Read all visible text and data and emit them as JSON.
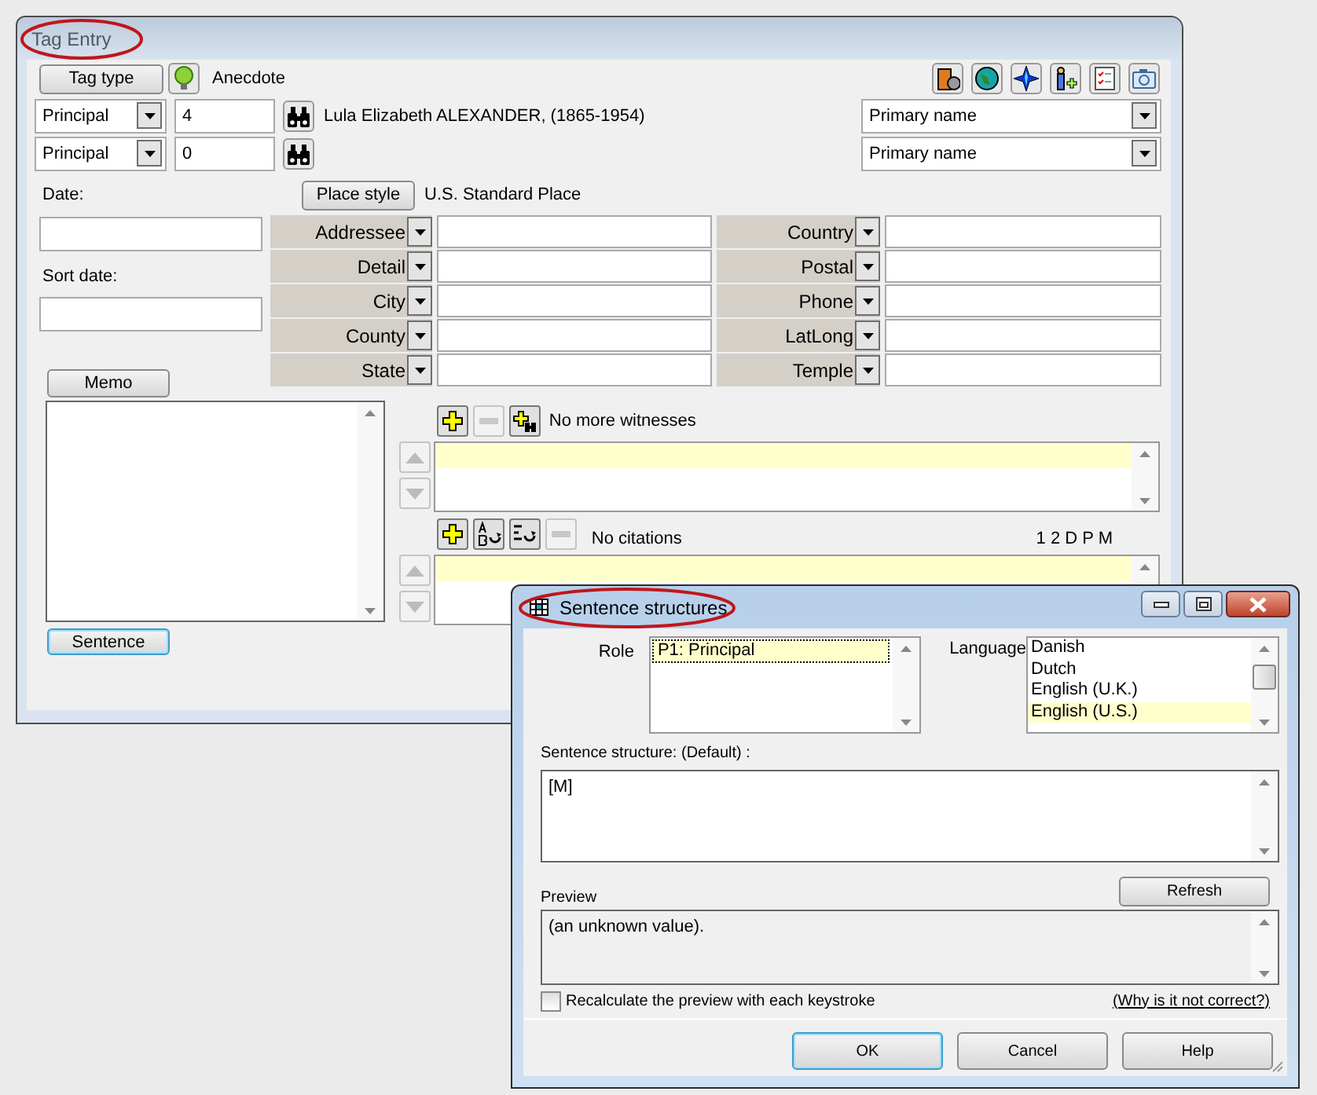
{
  "tag_entry": {
    "title": "Tag Entry",
    "title_circled": true,
    "tag_type_button": "Tag type",
    "tag_type": "Anecdote",
    "principals": [
      {
        "role": "Principal",
        "number": "4",
        "name": "Lula Elizabeth ALEXANDER, (1865-1954)",
        "name_type": "Primary name"
      },
      {
        "role": "Principal",
        "number": "0",
        "name_type": "Primary name"
      }
    ],
    "date_label": "Date:",
    "sort_date_label": "Sort date:",
    "place_style_button": "Place style",
    "place_style": "U.S. Standard Place",
    "place_fields": [
      {
        "label": "Addressee"
      },
      {
        "label": "Country"
      },
      {
        "label": "Detail"
      },
      {
        "label": "Postal"
      },
      {
        "label": "City"
      },
      {
        "label": "Phone"
      },
      {
        "label": "County"
      },
      {
        "label": "LatLong"
      },
      {
        "label": "State"
      },
      {
        "label": "Temple"
      }
    ],
    "memo_button": "Memo",
    "sentence_button": {
      "label": "Sentence",
      "focused": true
    },
    "witness_toolbar": {
      "buttons": [
        {
          "kind": "add",
          "disabled": false
        },
        {
          "kind": "remove",
          "disabled": true
        },
        {
          "kind": "find-add",
          "disabled": false
        }
      ],
      "status": "No more witnesses"
    },
    "citation_toolbar": {
      "buttons": [
        {
          "kind": "add",
          "disabled": false
        },
        {
          "kind": "ab-source",
          "disabled": false
        },
        {
          "kind": "list-source",
          "disabled": false
        },
        {
          "kind": "remove",
          "disabled": true
        }
      ],
      "status": "No citations",
      "flags": "1 2 D P M"
    }
  },
  "sentence_structures": {
    "title": "Sentence structures",
    "title_circled": true,
    "role_label": "Role",
    "roles": [
      {
        "label": "P1: Principal",
        "selected": true
      }
    ],
    "language_label": "Language",
    "languages": [
      {
        "label": "Danish",
        "selected": false
      },
      {
        "label": "Dutch",
        "selected": false
      },
      {
        "label": "English (U.K.)",
        "selected": false
      },
      {
        "label": "English (U.S.)",
        "selected": true
      }
    ],
    "structure_label": "Sentence structure: (Default) :",
    "structure": "[M]",
    "preview_label": "Preview",
    "refresh_button": "Refresh",
    "preview": "(an unknown value).",
    "recalculate": {
      "label": "Recalculate the preview with each keystroke",
      "checked": false
    },
    "why_link": "(Why is it not correct?)",
    "buttons": [
      {
        "label": "OK",
        "default": true
      },
      {
        "label": "Cancel",
        "default": false
      },
      {
        "label": "Help",
        "default": false
      }
    ]
  }
}
